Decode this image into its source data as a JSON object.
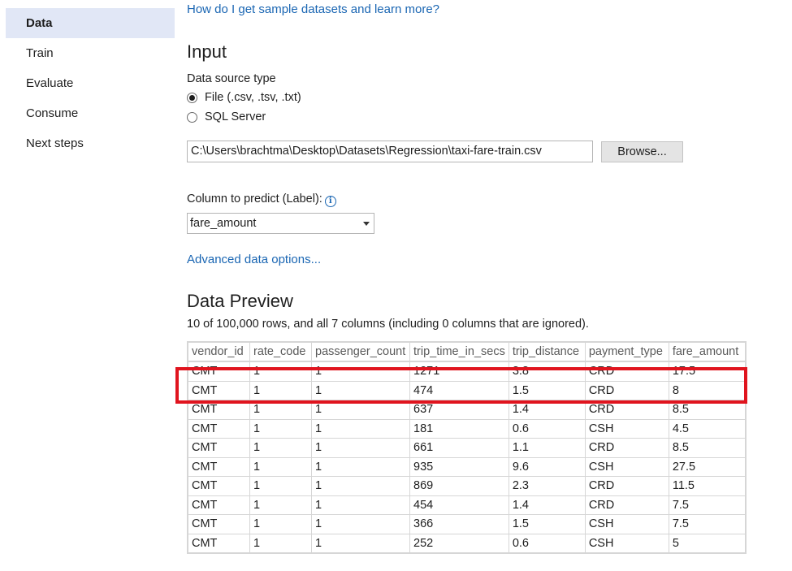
{
  "sidebar": {
    "items": [
      {
        "label": "Data",
        "active": true
      },
      {
        "label": "Train",
        "active": false
      },
      {
        "label": "Evaluate",
        "active": false
      },
      {
        "label": "Consume",
        "active": false
      },
      {
        "label": "Next steps",
        "active": false
      }
    ]
  },
  "main": {
    "help_link": "How do I get sample datasets and learn more?",
    "input_title": "Input",
    "data_source_label": "Data source type",
    "radio_file": "File (.csv, .tsv, .txt)",
    "radio_sql": "SQL Server",
    "file_path": "C:\\Users\\brachtma\\Desktop\\Datasets\\Regression\\taxi-fare-train.csv",
    "browse_label": "Browse...",
    "column_label": "Column to predict (Label):",
    "column_value": "fare_amount",
    "advanced_link": "Advanced data options...",
    "preview_title": "Data Preview",
    "preview_summary": "10 of 100,000 rows, and all 7 columns (including 0 columns that are ignored)."
  },
  "table": {
    "columns": [
      "vendor_id",
      "rate_code",
      "passenger_count",
      "trip_time_in_secs",
      "trip_distance",
      "payment_type",
      "fare_amount"
    ],
    "rows": [
      [
        "CMT",
        "1",
        "1",
        "1271",
        "3.8",
        "CRD",
        "17.5"
      ],
      [
        "CMT",
        "1",
        "1",
        "474",
        "1.5",
        "CRD",
        "8"
      ],
      [
        "CMT",
        "1",
        "1",
        "637",
        "1.4",
        "CRD",
        "8.5"
      ],
      [
        "CMT",
        "1",
        "1",
        "181",
        "0.6",
        "CSH",
        "4.5"
      ],
      [
        "CMT",
        "1",
        "1",
        "661",
        "1.1",
        "CRD",
        "8.5"
      ],
      [
        "CMT",
        "1",
        "1",
        "935",
        "9.6",
        "CSH",
        "27.5"
      ],
      [
        "CMT",
        "1",
        "1",
        "869",
        "2.3",
        "CRD",
        "11.5"
      ],
      [
        "CMT",
        "1",
        "1",
        "454",
        "1.4",
        "CRD",
        "7.5"
      ],
      [
        "CMT",
        "1",
        "1",
        "366",
        "1.5",
        "CSH",
        "7.5"
      ],
      [
        "CMT",
        "1",
        "1",
        "252",
        "0.6",
        "CSH",
        "5"
      ]
    ]
  },
  "colors": {
    "accent_link": "#1a66b3",
    "highlight": "#e0141e",
    "sidebar_active": "#e1e7f6"
  }
}
